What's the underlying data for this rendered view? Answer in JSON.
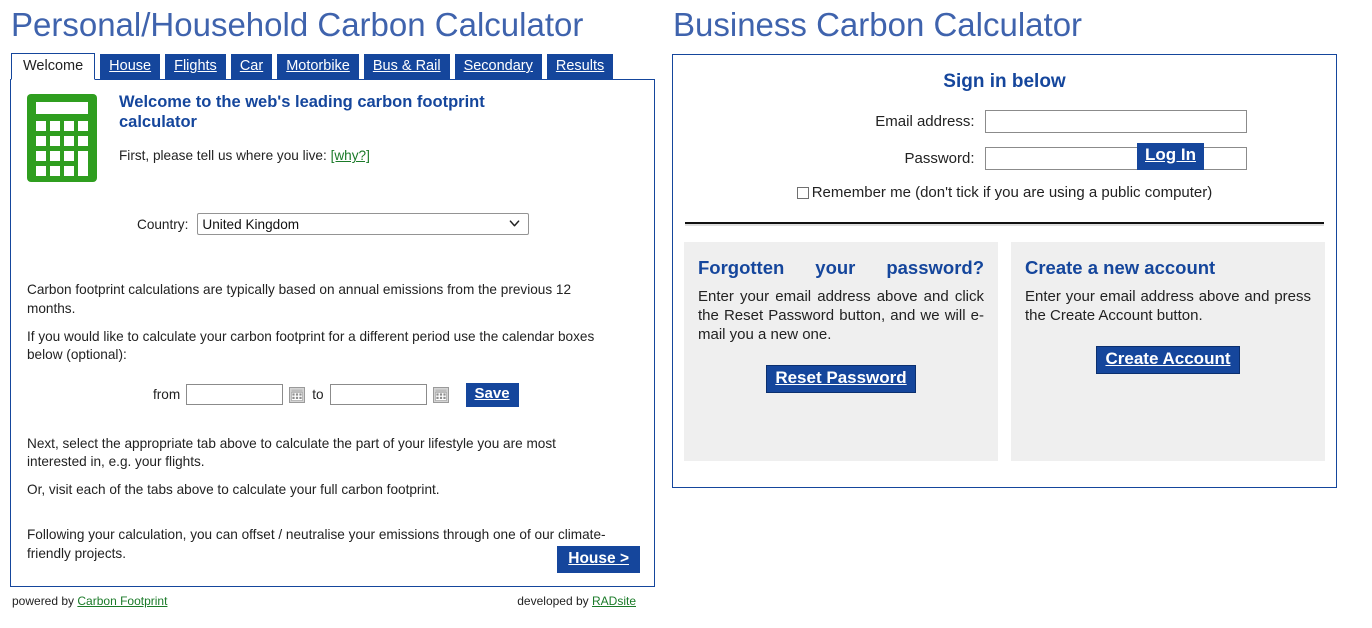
{
  "personal": {
    "title": "Personal/Household Carbon Calculator",
    "tabs": [
      {
        "label": "Welcome",
        "active": true
      },
      {
        "label": "House",
        "active": false
      },
      {
        "label": "Flights",
        "active": false
      },
      {
        "label": "Car",
        "active": false
      },
      {
        "label": "Motorbike",
        "active": false
      },
      {
        "label": "Bus & Rail",
        "active": false
      },
      {
        "label": "Secondary",
        "active": false
      },
      {
        "label": "Results",
        "active": false
      }
    ],
    "welcome_heading": "Welcome to the web's leading carbon footprint calculator",
    "live_prompt": "First, please tell us where you live:",
    "why_link": "[why?]",
    "country_label": "Country:",
    "country_value": "United Kingdom",
    "country_options": [
      "United Kingdom"
    ],
    "para_annual": "Carbon footprint calculations are typically based on annual emissions from the previous 12 months.",
    "para_period": "If you would like to calculate your carbon footprint for a different period use the calendar boxes below (optional):",
    "from_label": "from",
    "to_label": "to",
    "from_value": "",
    "to_value": "",
    "from_placeholder": "",
    "to_placeholder": "",
    "save_label": "Save",
    "para_next": "Next, select the appropriate tab above to calculate the part of your lifestyle you are most interested in, e.g. your flights.",
    "para_visit": "Or, visit each of the tabs above to calculate your full carbon footprint.",
    "para_offset": "Following your calculation, you can offset / neutralise your emissions through one of our climate-friendly projects.",
    "next_button": "House >",
    "footer_left_prefix": "powered by",
    "footer_left_link": "Carbon Footprint",
    "footer_right_prefix": "developed by",
    "footer_right_link": "RADsite"
  },
  "business": {
    "title": "Business Carbon Calculator",
    "signin_heading": "Sign in below",
    "email_label": "Email address:",
    "email_value": "",
    "email_placeholder": "",
    "password_label": "Password:",
    "password_value": "",
    "password_placeholder": "",
    "login_label": "Log In",
    "remember_label": "Remember me (don't tick if you are using a public computer)",
    "forgotten": {
      "heading_line1": "Forgotten",
      "heading_line2": "your",
      "heading_line3": "password?",
      "body": "Enter your email address above and click the Reset Password button, and we will e-mail you a new one.",
      "button": "Reset Password"
    },
    "create": {
      "heading": "Create a new account",
      "body": "Enter your email address above and press the Create Account button.",
      "button": "Create Account"
    }
  },
  "colors": {
    "brand_blue": "#15469c",
    "title_blue": "#3f63ad",
    "icon_green": "#2f9e1f",
    "link_green": "#1a7a28",
    "card_gray": "#efefef"
  },
  "icons": {
    "calculator": "calculator-icon",
    "calendar": "calendar-icon",
    "chevron_down": "chevron-down-icon",
    "checkbox": "checkbox-icon"
  }
}
